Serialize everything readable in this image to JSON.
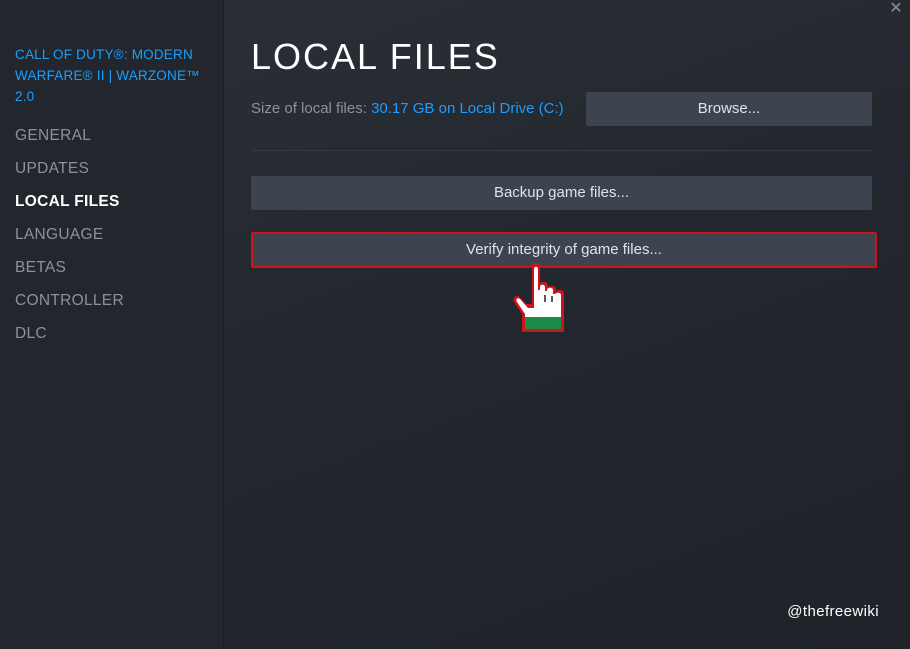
{
  "sidebar": {
    "game_title": "CALL OF DUTY®: MODERN WARFARE® II | WARZONE™ 2.0",
    "items": [
      {
        "label": "GENERAL"
      },
      {
        "label": "UPDATES"
      },
      {
        "label": "LOCAL FILES",
        "active": true
      },
      {
        "label": "LANGUAGE"
      },
      {
        "label": "BETAS"
      },
      {
        "label": "CONTROLLER"
      },
      {
        "label": "DLC"
      }
    ]
  },
  "main": {
    "close_icon": "close-icon",
    "title": "LOCAL FILES",
    "size_label": "Size of local files: ",
    "size_value": "30.17 GB on Local Drive (C:)",
    "browse_label": "Browse...",
    "backup_label": "Backup game files...",
    "verify_label": "Verify integrity of game files..."
  },
  "overlay": {
    "cursor_icon": "hand-pointer-icon",
    "highlight_color": "#d0121b",
    "watermark": "@thefreewiki"
  },
  "colors": {
    "accent": "#1a9fff",
    "button_bg": "#3d4450",
    "sidebar_bg": "#23262d"
  }
}
